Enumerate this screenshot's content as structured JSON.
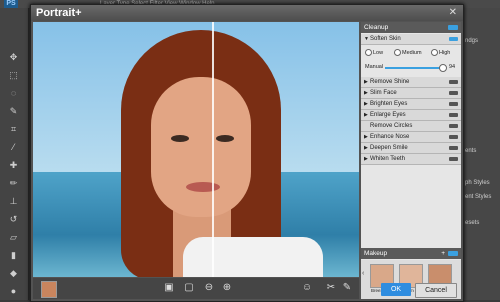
{
  "photoshop": {
    "logo": "PS",
    "menu_text": "Layer  Type  Select  Filter  View  Window  Help",
    "right_labels": [
      "ndgs",
      "ents",
      "ph Styles",
      "ent Styles",
      "esets"
    ]
  },
  "dialog": {
    "title": "Portrait+",
    "close": "✕"
  },
  "panel": {
    "header": "Cleanup",
    "soften_skin": "Soften Skin",
    "radios": [
      "Low",
      "Medium",
      "High"
    ],
    "manual_label": "Manual",
    "manual_value": "94",
    "manual_level": 0.94,
    "items": [
      "Remove Shine",
      "Slim Face",
      "Brighten Eyes",
      "Enlarge Eyes",
      "Remove Circles",
      "Enhance Nose",
      "Deepen Smile",
      "Whiten Teeth"
    ]
  },
  "makeup": {
    "header": "Makeup",
    "add": "+",
    "presets": [
      "Breeze",
      "Glam",
      "Honey"
    ]
  },
  "buttons": {
    "ok": "OK",
    "cancel": "Cancel"
  },
  "colors": {
    "accent": "#3aa0e0",
    "ok_bg": "#2f8de0"
  }
}
